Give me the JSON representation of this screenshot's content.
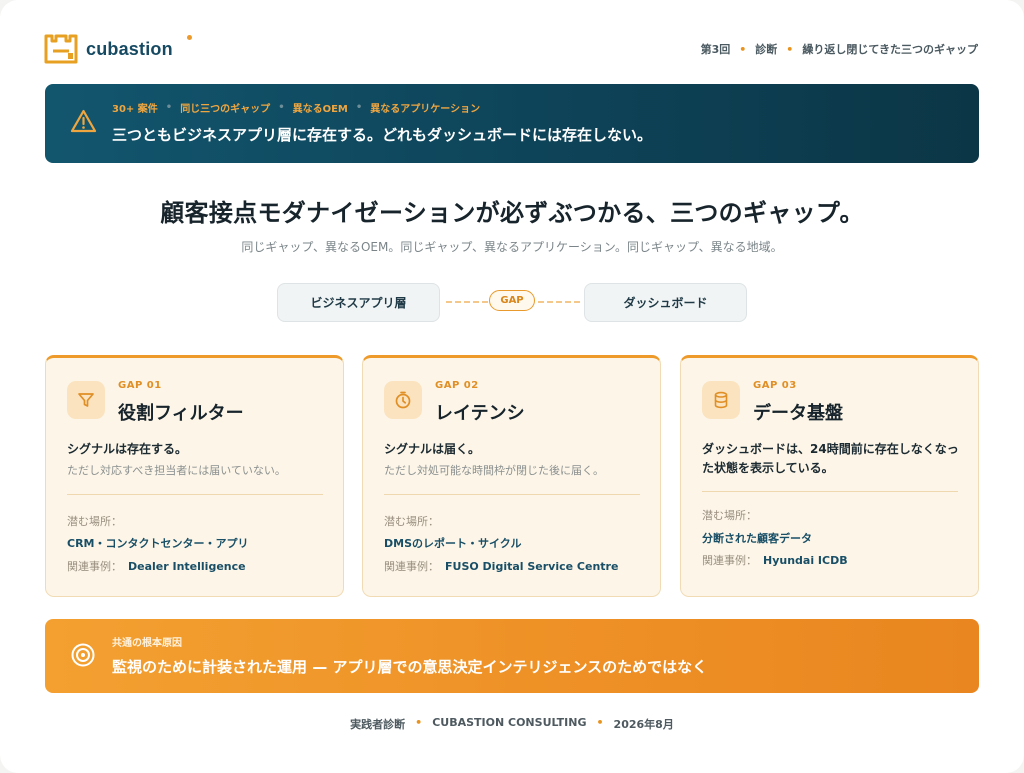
{
  "header": {
    "brand": "cubastion",
    "breadcrumb": [
      "第3回",
      "診断",
      "繰り返し閉じてきた三つのギャップ"
    ]
  },
  "banner": {
    "tags": [
      "30+ 案件",
      "同じ三つのギャップ",
      "異なるOEM",
      "異なるアプリケーション"
    ],
    "message": "三つともビジネスアプリ層に存在する。どれもダッシュボードには存在しない。"
  },
  "main": {
    "title": "顧客接点モダナイゼーションが必ずぶつかる、三つのギャップ。",
    "subtitle": "同じギャップ、異なるOEM。同じギャップ、異なるアプリケーション。同じギャップ、異なる地域。"
  },
  "diagram": {
    "left": "ビジネスアプリ層",
    "gap": "GAP",
    "right": "ダッシュボード"
  },
  "cards": [
    {
      "label": "GAP 01",
      "title": "役割フィルター",
      "lead": "シグナルは存在する。",
      "note": "ただし対応すべき担当者には届いていない。",
      "where_label": "潜む場所：",
      "where": "CRM・コンタクトセンター・アプリ",
      "case_label": "関連事例：",
      "case": "Dealer Intelligence",
      "icon": "filter-icon"
    },
    {
      "label": "GAP 02",
      "title": "レイテンシ",
      "lead": "シグナルは届く。",
      "note": "ただし対処可能な時間枠が閉じた後に届く。",
      "where_label": "潜む場所：",
      "where": "DMSのレポート・サイクル",
      "case_label": "関連事例：",
      "case": "FUSO Digital Service Centre",
      "icon": "stopwatch-icon"
    },
    {
      "label": "GAP 03",
      "title": "データ基盤",
      "lead": "ダッシュボードは、24時間前に存在しなくなった状態を表示している。",
      "where_label": "潜む場所：",
      "where": "分断された顧客データ",
      "case_label": "関連事例：",
      "case": "Hyundai ICDB",
      "icon": "database-icon"
    }
  ],
  "root_cause": {
    "label": "共通の根本原因",
    "message": "監視のために計装された運用 — アプリ層での意思決定インテリジェンスのためではなく"
  },
  "footer": [
    "実践者診断",
    "CUBASTION CONSULTING",
    "2026年8月"
  ],
  "colors": {
    "brand": "#164a63",
    "accent": "#ee9a2b",
    "banner": "#0e4358",
    "card_bg": "#fdf6e8"
  }
}
